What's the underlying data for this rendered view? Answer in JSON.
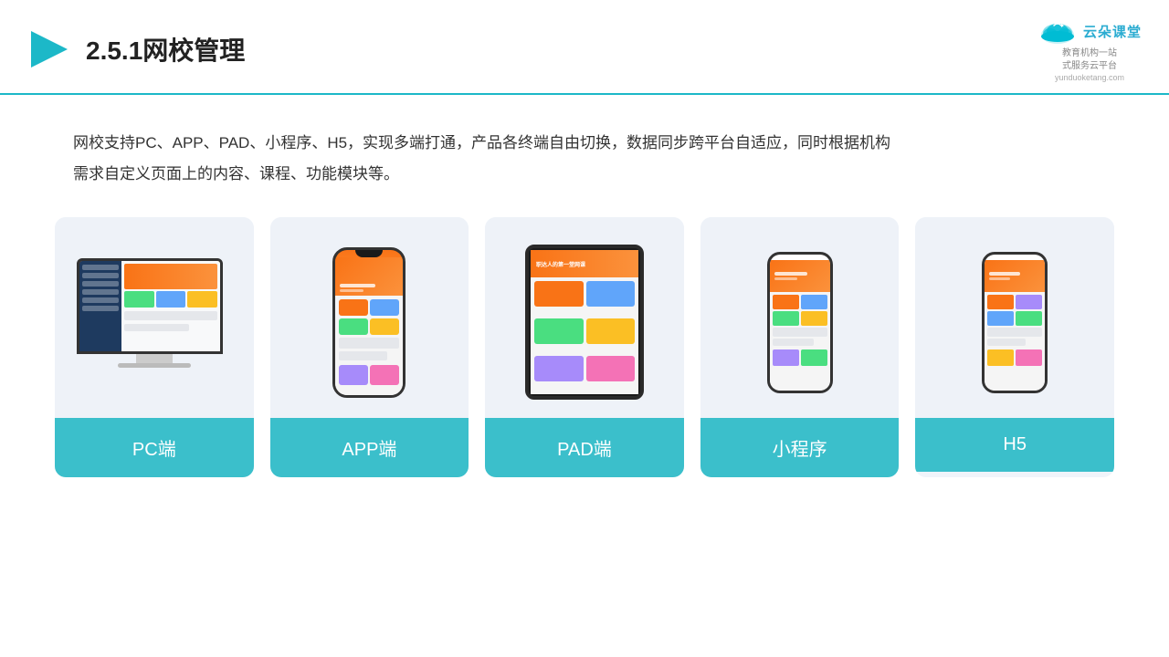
{
  "header": {
    "title": "2.5.1网校管理",
    "logo_text": "云朵课堂",
    "logo_sub": "教育机构一站\n式服务云平台",
    "logo_url": "yunduoketang.com"
  },
  "description": {
    "text": "网校支持PC、APP、PAD、小程序、H5，实现多端打通，产品各终端自由切换，数据同步跨平台自适应，同时根据机构\n需求自定义页面上的内容、课程、功能模块等。"
  },
  "cards": [
    {
      "id": "pc",
      "label": "PC端"
    },
    {
      "id": "app",
      "label": "APP端"
    },
    {
      "id": "pad",
      "label": "PAD端"
    },
    {
      "id": "miniapp",
      "label": "小程序"
    },
    {
      "id": "h5",
      "label": "H5"
    }
  ],
  "colors": {
    "accent": "#3bbfcb",
    "title_blue": "#1cb8c8",
    "header_border": "#1cb8c8"
  }
}
